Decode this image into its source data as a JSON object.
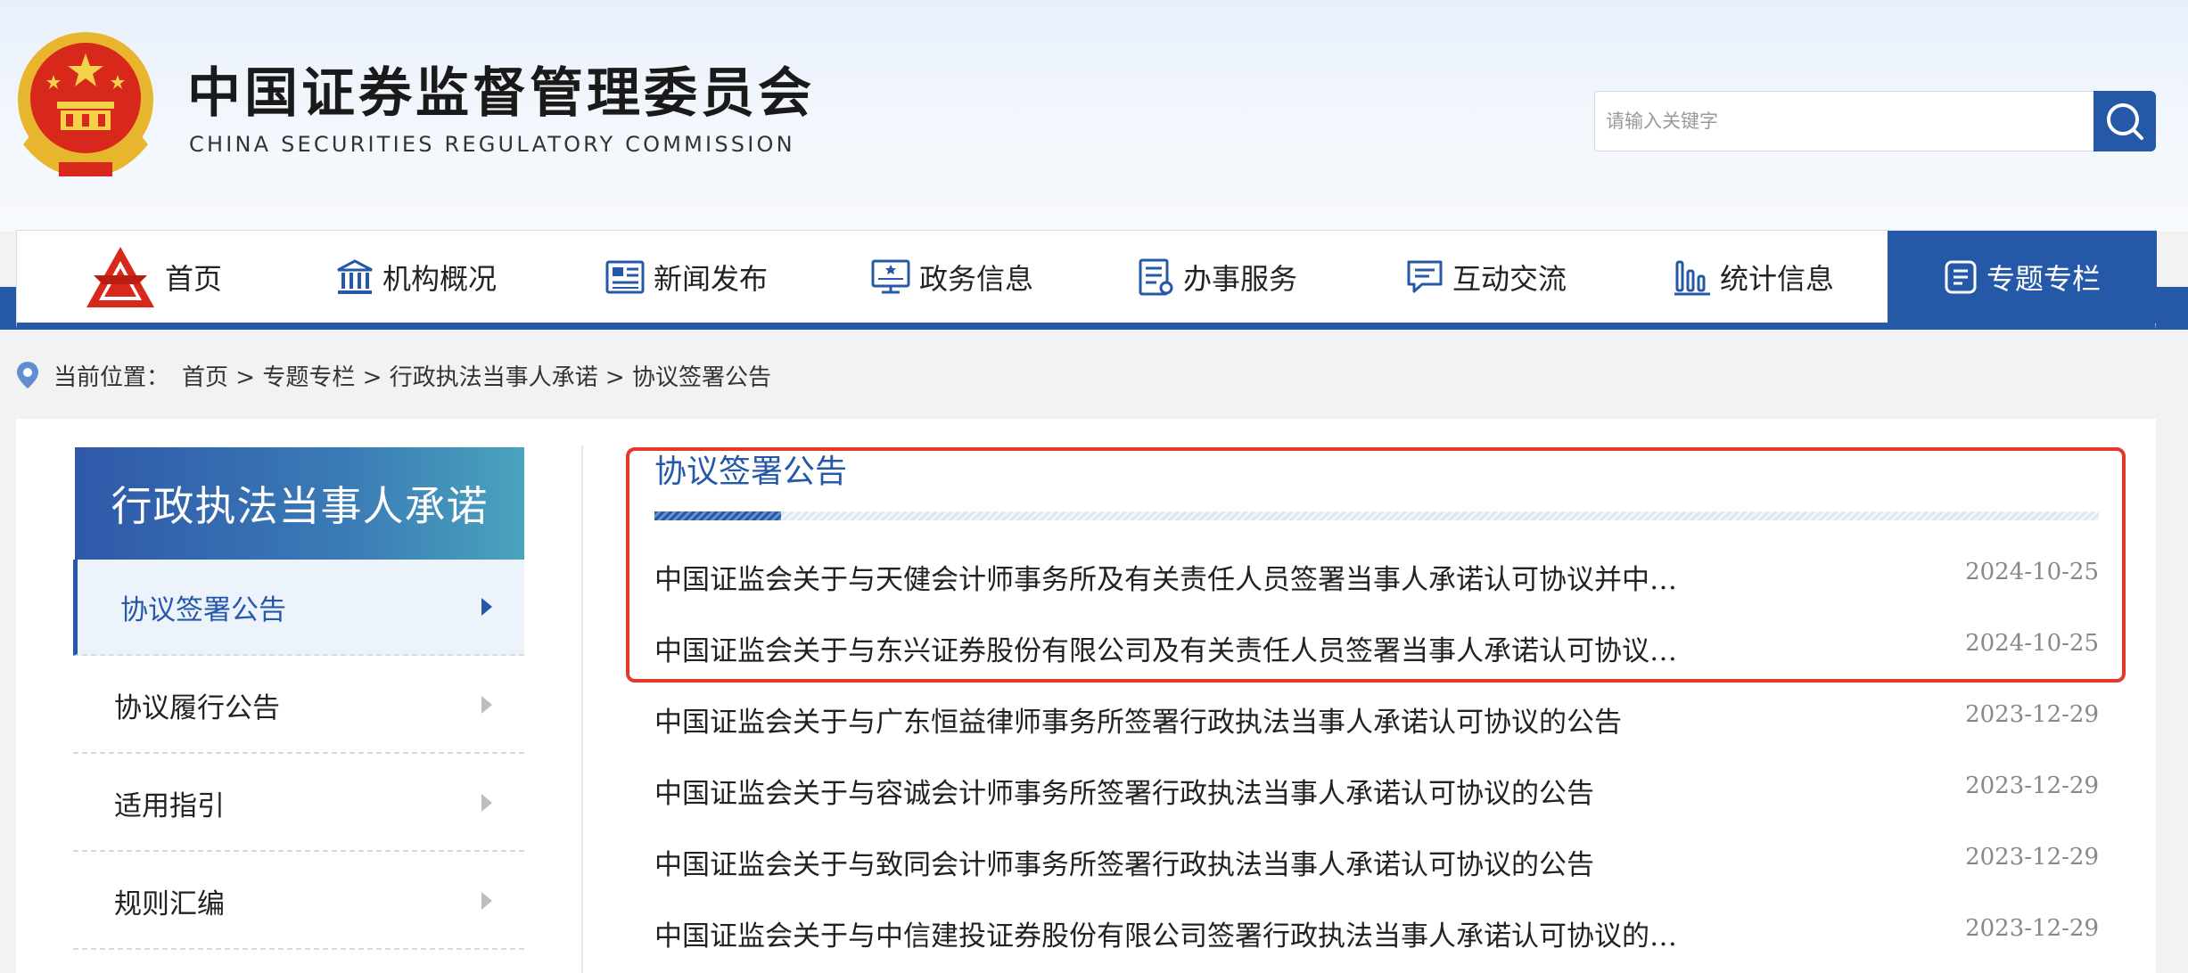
{
  "header": {
    "top_links": [
      "",
      "",
      "",
      "",
      ""
    ],
    "title_cn": "中国证券监督管理委员会",
    "title_en": "CHINA SECURITIES REGULATORY COMMISSION",
    "search": {
      "placeholder": "请输入关键字",
      "value": ""
    }
  },
  "nav": {
    "items": [
      {
        "label": "首页",
        "icon": "csrc-logo-icon"
      },
      {
        "label": "机构概况",
        "icon": "building-icon"
      },
      {
        "label": "新闻发布",
        "icon": "newspaper-icon"
      },
      {
        "label": "政务信息",
        "icon": "monitor-icon"
      },
      {
        "label": "办事服务",
        "icon": "document-list-icon"
      },
      {
        "label": "互动交流",
        "icon": "chat-icon"
      },
      {
        "label": "统计信息",
        "icon": "bar-chart-icon"
      },
      {
        "label": "专题专栏",
        "icon": "notepad-icon",
        "active": true
      }
    ]
  },
  "breadcrumb": {
    "prefix": "当前位置：",
    "path": "首页 > 专题专栏 > 行政执法当事人承诺 > 协议签署公告"
  },
  "sidebar": {
    "title": "行政执法当事人承诺",
    "items": [
      {
        "label": "协议签署公告",
        "active": true
      },
      {
        "label": "协议履行公告"
      },
      {
        "label": "适用指引"
      },
      {
        "label": "规则汇编"
      }
    ]
  },
  "main": {
    "section_title": "协议签署公告",
    "items": [
      {
        "title": "中国证监会关于与天健会计师事务所及有关责任人员签署当事人承诺认可协议并中…",
        "date": "2024-10-25"
      },
      {
        "title": "中国证监会关于与东兴证券股份有限公司及有关责任人员签署当事人承诺认可协议…",
        "date": "2024-10-25"
      },
      {
        "title": "中国证监会关于与广东恒益律师事务所签署行政执法当事人承诺认可协议的公告",
        "date": "2023-12-29"
      },
      {
        "title": "中国证监会关于与容诚会计师事务所签署行政执法当事人承诺认可协议的公告",
        "date": "2023-12-29"
      },
      {
        "title": "中国证监会关于与致同会计师事务所签署行政执法当事人承诺认可协议的公告",
        "date": "2023-12-29"
      },
      {
        "title": "中国证监会关于与中信建投证券股份有限公司签署行政执法当事人承诺认可协议的…",
        "date": "2023-12-29"
      }
    ]
  },
  "colors": {
    "brand": "#2559a8",
    "highlight": "#e2392b"
  }
}
